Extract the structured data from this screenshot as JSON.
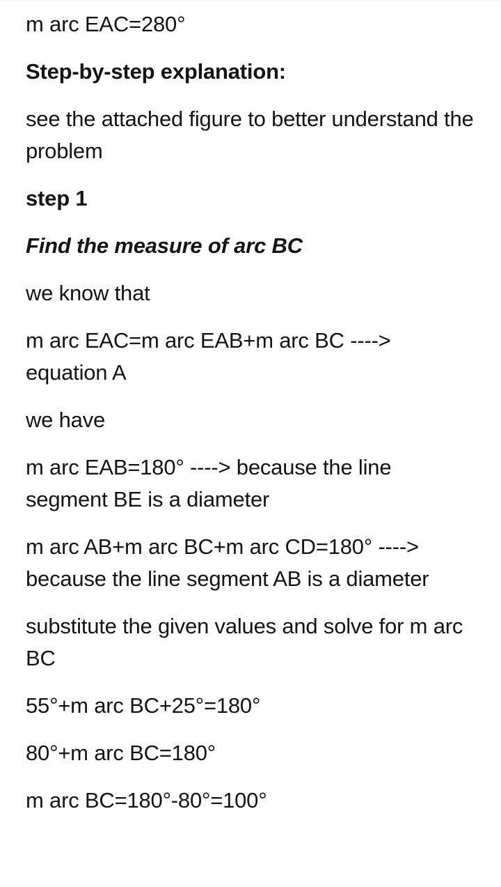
{
  "document": {
    "background_color": "#ffffff",
    "text_color": "#141414",
    "blocks": [
      {
        "id": "answer_line",
        "style": "normal",
        "text": "m arc EAC=280°"
      },
      {
        "id": "explanation_heading",
        "style": "bold",
        "text": "Step-by-step explanation:"
      },
      {
        "id": "see_figure",
        "style": "normal",
        "text": "see the attached figure to better understand the problem"
      },
      {
        "id": "step_1_label",
        "style": "bold",
        "text": "step 1"
      },
      {
        "id": "step_1_title",
        "style": "bolditalic",
        "text": "Find the measure of arc BC"
      },
      {
        "id": "we_know_that",
        "style": "normal",
        "text": "we know that"
      },
      {
        "id": "equation_a",
        "style": "normal",
        "text": "m arc EAC=m arc EAB+m arc BC ----> equation A"
      },
      {
        "id": "we_have",
        "style": "normal",
        "text": "we have"
      },
      {
        "id": "eab_180",
        "style": "normal",
        "text": "m arc EAB=180° ----> because the line segment BE is a diameter"
      },
      {
        "id": "ab_bc_cd_180",
        "style": "normal",
        "text": "m arc AB+m arc BC+m arc CD=180° ----> because the line segment AB is a diameter"
      },
      {
        "id": "substitute_instruction",
        "style": "normal",
        "text": "substitute the given values and solve for m arc BC"
      },
      {
        "id": "calc_line_1",
        "style": "normal",
        "text": "55°+m arc BC+25°=180°"
      },
      {
        "id": "calc_line_2",
        "style": "normal",
        "text": "80°+m arc BC=180°"
      },
      {
        "id": "calc_line_3",
        "style": "normal",
        "text": "m arc BC=180°-80°=100°"
      }
    ]
  }
}
